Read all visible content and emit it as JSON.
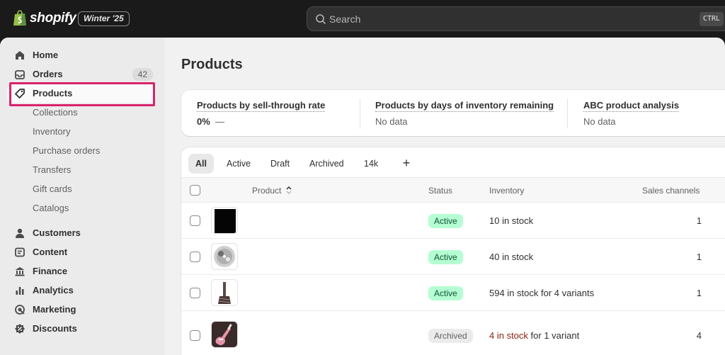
{
  "topbar": {
    "brand": "shopify",
    "edition": "Winter '25",
    "search_placeholder": "Search",
    "shortcut": "CTRL"
  },
  "sidebar": {
    "items": [
      {
        "label": "Home",
        "icon": "home-icon"
      },
      {
        "label": "Orders",
        "icon": "inbox-icon",
        "count": "42"
      },
      {
        "label": "Products",
        "icon": "tag-icon",
        "selected": true
      },
      {
        "label": "Collections"
      },
      {
        "label": "Inventory"
      },
      {
        "label": "Purchase orders"
      },
      {
        "label": "Transfers"
      },
      {
        "label": "Gift cards"
      },
      {
        "label": "Catalogs"
      },
      {
        "label": "Customers",
        "icon": "person-icon"
      },
      {
        "label": "Content",
        "icon": "content-icon"
      },
      {
        "label": "Finance",
        "icon": "bank-icon"
      },
      {
        "label": "Analytics",
        "icon": "bar-chart-icon"
      },
      {
        "label": "Marketing",
        "icon": "target-icon"
      },
      {
        "label": "Discounts",
        "icon": "discount-icon"
      }
    ]
  },
  "page": {
    "title": "Products"
  },
  "analytics": [
    {
      "title": "Products by sell-through rate",
      "value": "0%",
      "suffix": "—"
    },
    {
      "title": "Products by days of inventory remaining",
      "value": "No data"
    },
    {
      "title": "ABC product analysis",
      "value": "No data"
    }
  ],
  "tabs": [
    "All",
    "Active",
    "Draft",
    "Archived",
    "14k"
  ],
  "table": {
    "columns": [
      "Product",
      "Status",
      "Inventory",
      "Sales channels"
    ],
    "rows": [
      {
        "status": "Active",
        "inventory": "10 in stock",
        "channels": "1"
      },
      {
        "status": "Active",
        "inventory": "40 in stock",
        "channels": "1"
      },
      {
        "status": "Active",
        "inventory": "594 in stock for 4 variants",
        "channels": "1"
      },
      {
        "status": "Archived",
        "inventory_warn": "4 in stock",
        "inventory_rest": " for 1 variant",
        "channels": "4"
      }
    ]
  },
  "colors": {
    "accent_highlight": "#d8246b",
    "active_badge": "#b4fed2",
    "archived_badge": "#ebebeb"
  }
}
